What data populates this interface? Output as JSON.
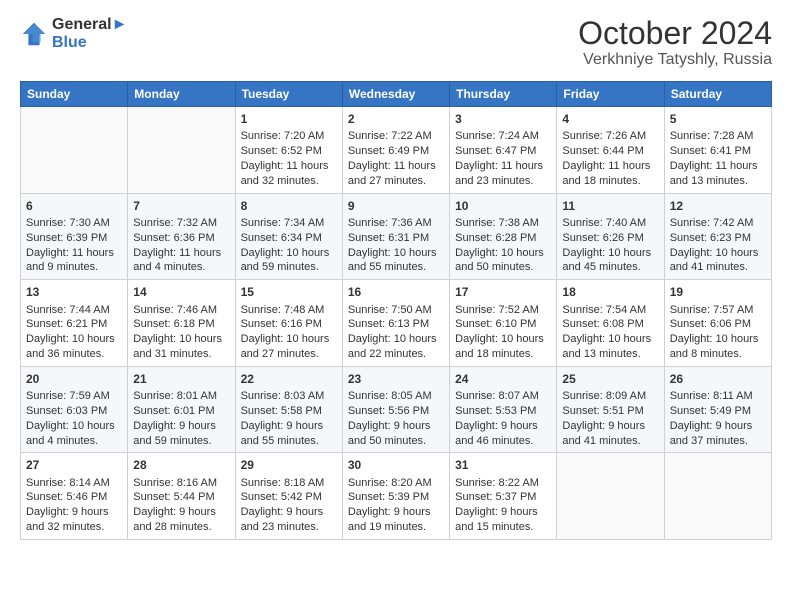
{
  "logo": {
    "line1": "General",
    "line2": "Blue"
  },
  "title": "October 2024",
  "subtitle": "Verkhniye Tatyshly, Russia",
  "headers": [
    "Sunday",
    "Monday",
    "Tuesday",
    "Wednesday",
    "Thursday",
    "Friday",
    "Saturday"
  ],
  "weeks": [
    [
      {
        "day": "",
        "lines": []
      },
      {
        "day": "",
        "lines": []
      },
      {
        "day": "1",
        "lines": [
          "Sunrise: 7:20 AM",
          "Sunset: 6:52 PM",
          "Daylight: 11 hours",
          "and 32 minutes."
        ]
      },
      {
        "day": "2",
        "lines": [
          "Sunrise: 7:22 AM",
          "Sunset: 6:49 PM",
          "Daylight: 11 hours",
          "and 27 minutes."
        ]
      },
      {
        "day": "3",
        "lines": [
          "Sunrise: 7:24 AM",
          "Sunset: 6:47 PM",
          "Daylight: 11 hours",
          "and 23 minutes."
        ]
      },
      {
        "day": "4",
        "lines": [
          "Sunrise: 7:26 AM",
          "Sunset: 6:44 PM",
          "Daylight: 11 hours",
          "and 18 minutes."
        ]
      },
      {
        "day": "5",
        "lines": [
          "Sunrise: 7:28 AM",
          "Sunset: 6:41 PM",
          "Daylight: 11 hours",
          "and 13 minutes."
        ]
      }
    ],
    [
      {
        "day": "6",
        "lines": [
          "Sunrise: 7:30 AM",
          "Sunset: 6:39 PM",
          "Daylight: 11 hours",
          "and 9 minutes."
        ]
      },
      {
        "day": "7",
        "lines": [
          "Sunrise: 7:32 AM",
          "Sunset: 6:36 PM",
          "Daylight: 11 hours",
          "and 4 minutes."
        ]
      },
      {
        "day": "8",
        "lines": [
          "Sunrise: 7:34 AM",
          "Sunset: 6:34 PM",
          "Daylight: 10 hours",
          "and 59 minutes."
        ]
      },
      {
        "day": "9",
        "lines": [
          "Sunrise: 7:36 AM",
          "Sunset: 6:31 PM",
          "Daylight: 10 hours",
          "and 55 minutes."
        ]
      },
      {
        "day": "10",
        "lines": [
          "Sunrise: 7:38 AM",
          "Sunset: 6:28 PM",
          "Daylight: 10 hours",
          "and 50 minutes."
        ]
      },
      {
        "day": "11",
        "lines": [
          "Sunrise: 7:40 AM",
          "Sunset: 6:26 PM",
          "Daylight: 10 hours",
          "and 45 minutes."
        ]
      },
      {
        "day": "12",
        "lines": [
          "Sunrise: 7:42 AM",
          "Sunset: 6:23 PM",
          "Daylight: 10 hours",
          "and 41 minutes."
        ]
      }
    ],
    [
      {
        "day": "13",
        "lines": [
          "Sunrise: 7:44 AM",
          "Sunset: 6:21 PM",
          "Daylight: 10 hours",
          "and 36 minutes."
        ]
      },
      {
        "day": "14",
        "lines": [
          "Sunrise: 7:46 AM",
          "Sunset: 6:18 PM",
          "Daylight: 10 hours",
          "and 31 minutes."
        ]
      },
      {
        "day": "15",
        "lines": [
          "Sunrise: 7:48 AM",
          "Sunset: 6:16 PM",
          "Daylight: 10 hours",
          "and 27 minutes."
        ]
      },
      {
        "day": "16",
        "lines": [
          "Sunrise: 7:50 AM",
          "Sunset: 6:13 PM",
          "Daylight: 10 hours",
          "and 22 minutes."
        ]
      },
      {
        "day": "17",
        "lines": [
          "Sunrise: 7:52 AM",
          "Sunset: 6:10 PM",
          "Daylight: 10 hours",
          "and 18 minutes."
        ]
      },
      {
        "day": "18",
        "lines": [
          "Sunrise: 7:54 AM",
          "Sunset: 6:08 PM",
          "Daylight: 10 hours",
          "and 13 minutes."
        ]
      },
      {
        "day": "19",
        "lines": [
          "Sunrise: 7:57 AM",
          "Sunset: 6:06 PM",
          "Daylight: 10 hours",
          "and 8 minutes."
        ]
      }
    ],
    [
      {
        "day": "20",
        "lines": [
          "Sunrise: 7:59 AM",
          "Sunset: 6:03 PM",
          "Daylight: 10 hours",
          "and 4 minutes."
        ]
      },
      {
        "day": "21",
        "lines": [
          "Sunrise: 8:01 AM",
          "Sunset: 6:01 PM",
          "Daylight: 9 hours",
          "and 59 minutes."
        ]
      },
      {
        "day": "22",
        "lines": [
          "Sunrise: 8:03 AM",
          "Sunset: 5:58 PM",
          "Daylight: 9 hours",
          "and 55 minutes."
        ]
      },
      {
        "day": "23",
        "lines": [
          "Sunrise: 8:05 AM",
          "Sunset: 5:56 PM",
          "Daylight: 9 hours",
          "and 50 minutes."
        ]
      },
      {
        "day": "24",
        "lines": [
          "Sunrise: 8:07 AM",
          "Sunset: 5:53 PM",
          "Daylight: 9 hours",
          "and 46 minutes."
        ]
      },
      {
        "day": "25",
        "lines": [
          "Sunrise: 8:09 AM",
          "Sunset: 5:51 PM",
          "Daylight: 9 hours",
          "and 41 minutes."
        ]
      },
      {
        "day": "26",
        "lines": [
          "Sunrise: 8:11 AM",
          "Sunset: 5:49 PM",
          "Daylight: 9 hours",
          "and 37 minutes."
        ]
      }
    ],
    [
      {
        "day": "27",
        "lines": [
          "Sunrise: 8:14 AM",
          "Sunset: 5:46 PM",
          "Daylight: 9 hours",
          "and 32 minutes."
        ]
      },
      {
        "day": "28",
        "lines": [
          "Sunrise: 8:16 AM",
          "Sunset: 5:44 PM",
          "Daylight: 9 hours",
          "and 28 minutes."
        ]
      },
      {
        "day": "29",
        "lines": [
          "Sunrise: 8:18 AM",
          "Sunset: 5:42 PM",
          "Daylight: 9 hours",
          "and 23 minutes."
        ]
      },
      {
        "day": "30",
        "lines": [
          "Sunrise: 8:20 AM",
          "Sunset: 5:39 PM",
          "Daylight: 9 hours",
          "and 19 minutes."
        ]
      },
      {
        "day": "31",
        "lines": [
          "Sunrise: 8:22 AM",
          "Sunset: 5:37 PM",
          "Daylight: 9 hours",
          "and 15 minutes."
        ]
      },
      {
        "day": "",
        "lines": []
      },
      {
        "day": "",
        "lines": []
      }
    ]
  ]
}
